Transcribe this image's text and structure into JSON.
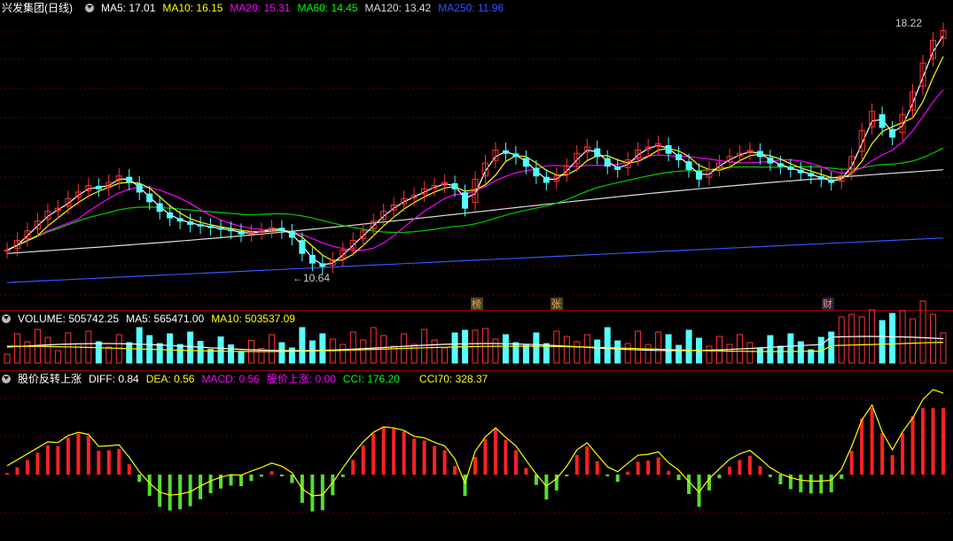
{
  "title": "兴发集团(日线)",
  "ma": [
    {
      "label": "MA5:",
      "value": "17.01",
      "color": "#ffffff"
    },
    {
      "label": "MA10:",
      "value": "16.15",
      "color": "#ffff00"
    },
    {
      "label": "MA20:",
      "value": "15.31",
      "color": "#ff00ff"
    },
    {
      "label": "MA60:",
      "value": "14.45",
      "color": "#00ff00"
    },
    {
      "label": "MA120:",
      "value": "13.42",
      "color": "#dddddd"
    },
    {
      "label": "MA250:",
      "value": "11.96",
      "color": "#3355ff"
    }
  ],
  "high_label": "18.22",
  "low_label": "10.64",
  "events": [
    "榜",
    "张",
    "财"
  ],
  "volume": {
    "label": "VOLUME:",
    "value": "505742.25",
    "ma5_label": "MA5:",
    "ma5": "565471.00",
    "ma10_label": "MA10:",
    "ma10": "503537.09"
  },
  "indicator": {
    "name": "股价反转上涨",
    "diff_label": "DIFF:",
    "diff": "0.84",
    "dea_label": "DEA:",
    "dea": "0.56",
    "macd_label": "MACD:",
    "macd": "0.56",
    "up_label": "股价上涨:",
    "up": "0.00",
    "cci_label": "CCI:",
    "cci": "176.20",
    "cci70_label": "CCI70:",
    "cci70": "328.37"
  },
  "chart_data": {
    "type": "candlestick",
    "closes": [
      11.3,
      11.6,
      11.9,
      12.2,
      12.5,
      12.6,
      12.9,
      13.1,
      13.3,
      13.2,
      13.4,
      13.6,
      13.4,
      13.1,
      12.8,
      12.5,
      12.3,
      12.2,
      12.1,
      12.05,
      12.0,
      11.95,
      11.9,
      11.8,
      11.85,
      11.9,
      12.0,
      11.9,
      11.7,
      11.2,
      10.9,
      10.8,
      11.0,
      11.3,
      11.6,
      11.9,
      12.2,
      12.5,
      12.7,
      12.9,
      13.0,
      13.2,
      13.3,
      13.4,
      13.2,
      12.6,
      13.5,
      14.0,
      14.4,
      14.3,
      14.2,
      13.9,
      13.6,
      13.4,
      13.6,
      13.9,
      14.3,
      14.5,
      14.2,
      13.9,
      13.8,
      14.1,
      14.4,
      14.5,
      14.6,
      14.3,
      14.1,
      13.8,
      13.5,
      13.8,
      14.0,
      14.2,
      14.3,
      14.4,
      14.2,
      14.0,
      13.9,
      13.8,
      13.7,
      13.6,
      13.5,
      13.4,
      13.6,
      14.2,
      15.0,
      15.6,
      15.1,
      14.8,
      15.5,
      16.2,
      17.1,
      17.8,
      18.1
    ],
    "price_ylim": [
      10.0,
      18.5
    ],
    "volume_ylim": [
      0,
      1000000
    ],
    "indicator_ylim": [
      -100,
      180
    ]
  }
}
